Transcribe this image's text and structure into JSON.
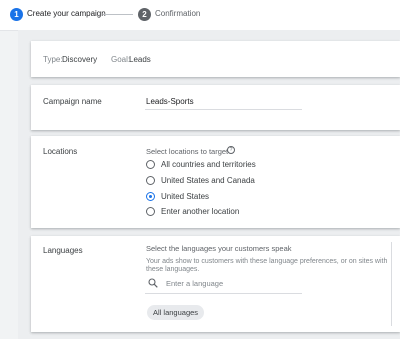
{
  "stepper": {
    "step1": {
      "number": "1",
      "label": "Create your campaign"
    },
    "step2": {
      "number": "2",
      "label": "Confirmation"
    }
  },
  "summary": {
    "type_label": "Type:",
    "type_value": "Discovery",
    "goal_label": "Goal:",
    "goal_value": "Leads"
  },
  "campaign_name": {
    "label": "Campaign name",
    "value": "Leads-Sports"
  },
  "locations": {
    "label": "Locations",
    "helper": "Select locations to target",
    "help_icon": "help-icon",
    "options": [
      {
        "label": "All countries and territories",
        "selected": false
      },
      {
        "label": "United States and Canada",
        "selected": false
      },
      {
        "label": "United States",
        "selected": true
      },
      {
        "label": "Enter another location",
        "selected": false
      }
    ]
  },
  "languages": {
    "label": "Languages",
    "helper": "Select the languages your customers speak",
    "description_line1": "Your ads show to customers with these language preferences, or on sites with",
    "description_line2": "these languages.",
    "search_placeholder": "Enter a language",
    "search_icon": "search-icon",
    "chip": "All languages"
  },
  "colors": {
    "accent": "#1a73e8",
    "background": "#f1f3f4",
    "card": "#ffffff"
  }
}
